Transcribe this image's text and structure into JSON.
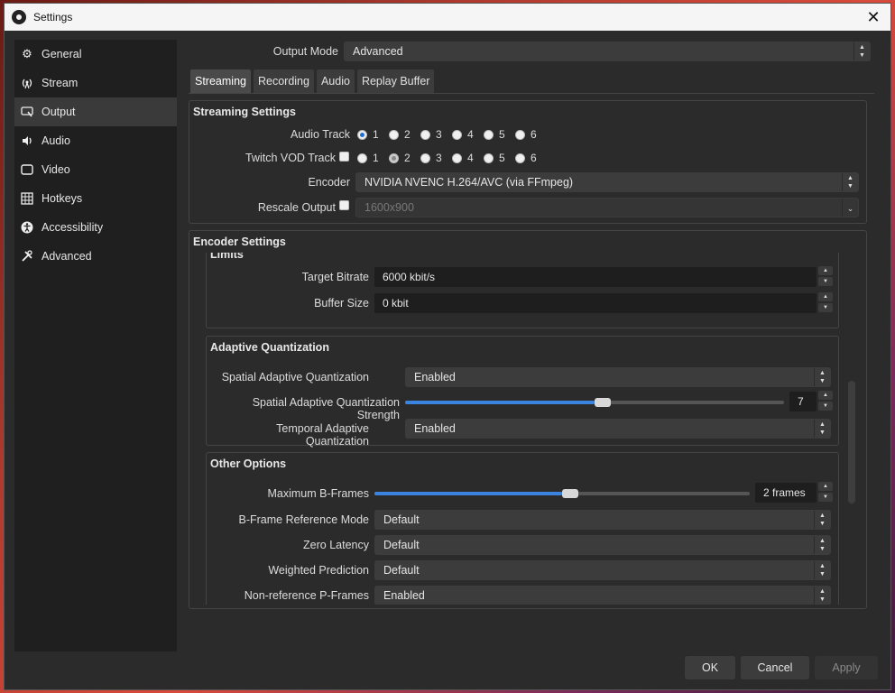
{
  "window": {
    "title": "Settings"
  },
  "sidebar": {
    "items": [
      {
        "label": "General",
        "icon": "gear-icon"
      },
      {
        "label": "Stream",
        "icon": "antenna-icon"
      },
      {
        "label": "Output",
        "icon": "output-icon"
      },
      {
        "label": "Audio",
        "icon": "speaker-icon"
      },
      {
        "label": "Video",
        "icon": "monitor-icon"
      },
      {
        "label": "Hotkeys",
        "icon": "keyboard-icon"
      },
      {
        "label": "Accessibility",
        "icon": "accessibility-icon"
      },
      {
        "label": "Advanced",
        "icon": "tools-icon"
      }
    ],
    "active": "Output"
  },
  "output_mode": {
    "label": "Output Mode",
    "value": "Advanced"
  },
  "tabs": [
    "Streaming",
    "Recording",
    "Audio",
    "Replay Buffer"
  ],
  "streaming_settings": {
    "title": "Streaming Settings",
    "audio_track_label": "Audio Track",
    "twitch_vod_label": "Twitch VOD Track",
    "track_numbers": [
      "1",
      "2",
      "3",
      "4",
      "5",
      "6"
    ],
    "audio_track_selected": "1",
    "twitch_vod_selected": "2",
    "encoder_label": "Encoder",
    "encoder_value": "NVIDIA NVENC H.264/AVC (via FFmpeg)",
    "rescale_label": "Rescale Output",
    "rescale_value": "1600x900"
  },
  "encoder_settings": {
    "title": "Encoder Settings",
    "limits": {
      "title": "Limits",
      "target_bitrate_label": "Target Bitrate",
      "target_bitrate_value": "6000 kbit/s",
      "buffer_size_label": "Buffer Size",
      "buffer_size_value": "0 kbit"
    },
    "adaptive_quantization": {
      "title": "Adaptive Quantization",
      "spatial_label": "Spatial Adaptive Quantization",
      "spatial_value": "Enabled",
      "strength_label": "Spatial Adaptive Quantization Strength",
      "strength_value": "7",
      "strength_fraction": 0.5,
      "temporal_label": "Temporal Adaptive Quantization",
      "temporal_value": "Enabled"
    },
    "other_options": {
      "title": "Other Options",
      "bframes_label": "Maximum B-Frames",
      "bframes_value": "2 frames",
      "bframes_fraction": 0.5,
      "bframe_ref_label": "B-Frame Reference Mode",
      "bframe_ref_value": "Default",
      "zero_latency_label": "Zero Latency",
      "zero_latency_value": "Default",
      "weighted_label": "Weighted Prediction",
      "weighted_value": "Default",
      "nonref_label": "Non-reference P-Frames",
      "nonref_value": "Enabled"
    }
  },
  "buttons": {
    "ok": "OK",
    "cancel": "Cancel",
    "apply": "Apply"
  },
  "colors": {
    "accent": "#3a84e0",
    "window_bg": "#2b2b2b",
    "sidebar_bg": "#1f1f1f"
  }
}
